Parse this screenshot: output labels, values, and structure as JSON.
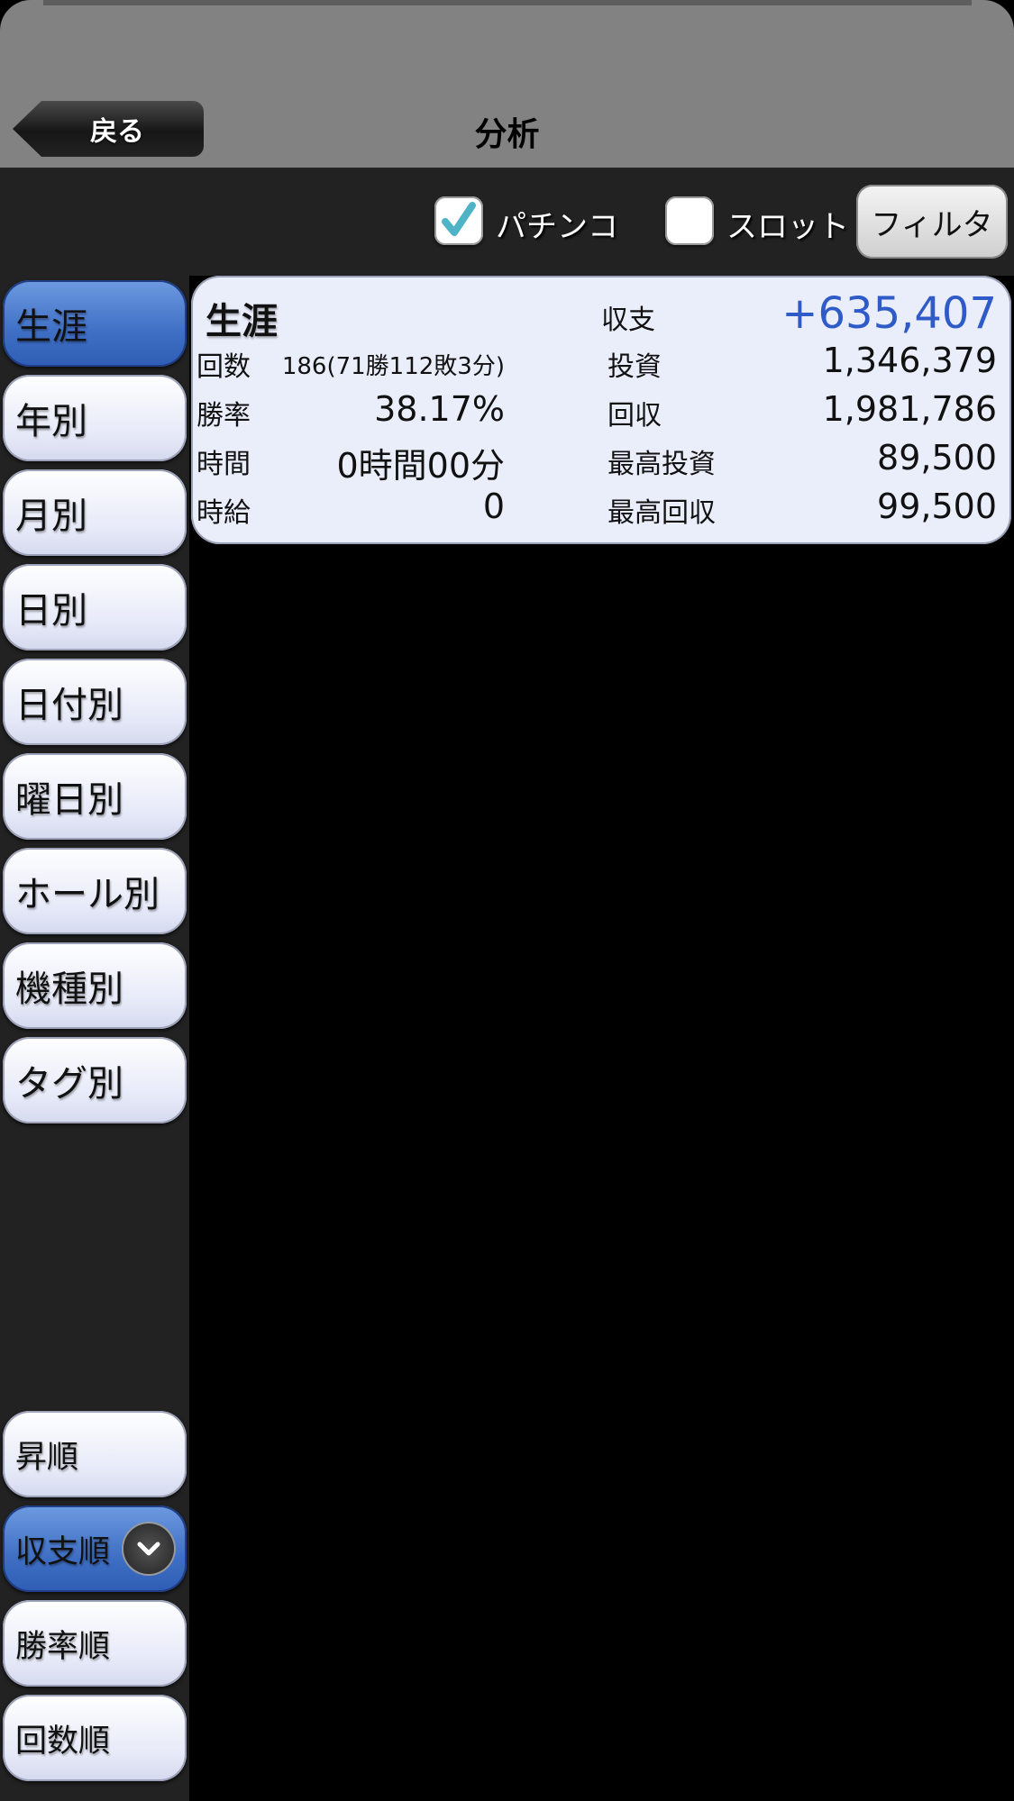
{
  "header": {
    "back_label": "戻る",
    "title": "分析"
  },
  "filter": {
    "pachinko_label": "パチンコ",
    "pachinko_checked": true,
    "slot_label": "スロット",
    "slot_checked": false,
    "filter_button": "フィルタ"
  },
  "sidebar": {
    "items": [
      "生涯",
      "年別",
      "月別",
      "日別",
      "日付別",
      "曜日別",
      "ホール別",
      "機種別",
      "タグ別"
    ],
    "active": "生涯"
  },
  "sort": {
    "items": [
      "昇順",
      "収支順",
      "勝率順",
      "回数順"
    ],
    "active": "収支順"
  },
  "summary": {
    "title": "生涯",
    "balance_label": "収支",
    "balance_value": "+635,407",
    "count_label": "回数",
    "count_value": "186(71勝112敗3分)",
    "invest_label": "投資",
    "invest_value": "1,346,379",
    "winrate_label": "勝率",
    "winrate_value": "38.17%",
    "return_label": "回収",
    "return_value": "1,981,786",
    "time_label": "時間",
    "time_value": "0時間00分",
    "max_invest_label": "最高投資",
    "max_invest_value": "89,500",
    "hourly_label": "時給",
    "hourly_value": "0",
    "max_return_label": "最高回収",
    "max_return_value": "99,500"
  },
  "colors": {
    "balance_positive": "#2f5bc8",
    "active_button": "#3f6fc5",
    "topbar": "#828282"
  }
}
